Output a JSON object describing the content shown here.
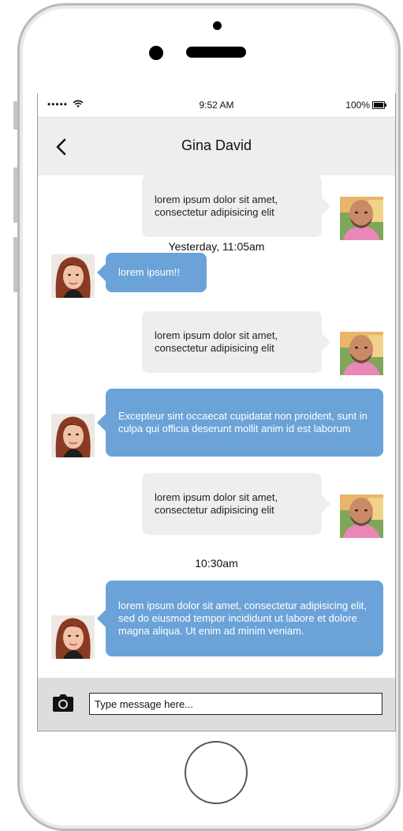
{
  "status_bar": {
    "signal": "•••••",
    "time": "9:52 AM",
    "battery": "100%"
  },
  "header": {
    "title": "Gina David",
    "back_icon": "chevron-left-icon"
  },
  "messages": [
    {
      "side": "in",
      "text": "lorem ipsum dolor sit amet, consectetur adipisicing elit"
    },
    {
      "side": "out",
      "text": "lorem ipsum!!"
    },
    {
      "side": "in",
      "text": "lorem ipsum dolor sit amet, consectetur adipisicing elit"
    },
    {
      "side": "out",
      "text": "Excepteur sint occaecat cupidatat non proident, sunt in culpa qui officia deserunt mollit anim id est laborum"
    },
    {
      "side": "in",
      "text": "lorem ipsum dolor sit amet, consectetur adipisicing elit"
    },
    {
      "side": "out",
      "text": "lorem ipsum dolor sit amet, consectetur adipisicing elit, sed do eiusmod tempor incididunt ut labore et dolore magna aliqua. Ut enim ad minim veniam."
    }
  ],
  "timestamps": [
    "Yesterday, 11:05am",
    "10:30am"
  ],
  "composer": {
    "placeholder": "Type message here...",
    "camera_icon": "camera-icon"
  },
  "colors": {
    "incoming_bubble": "#eeeeee",
    "outgoing_bubble": "#6ba3d8",
    "nav_bar": "#eeeeee",
    "input_bar": "#dddddd"
  }
}
